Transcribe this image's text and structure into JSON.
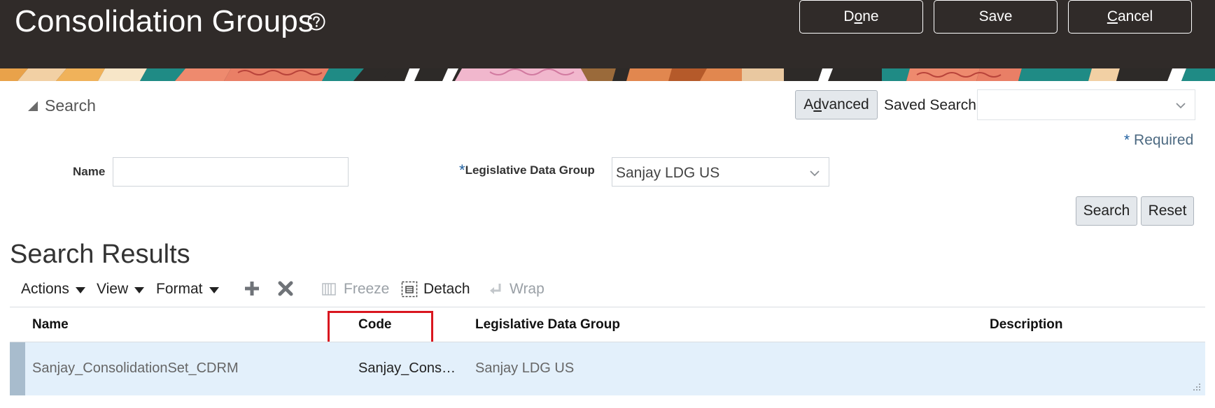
{
  "header": {
    "title": "Consolidation Groups",
    "help_icon": "help-question-circle-icon",
    "buttons": {
      "done_pre": "D",
      "done_ul": "o",
      "done_post": "ne",
      "save": "Save",
      "cancel_ul": "C",
      "cancel_post": "ancel"
    }
  },
  "search": {
    "toggle_label": "Search",
    "toggle_icon": "collapse-triangle-icon",
    "advanced_pre": "A",
    "advanced_ul": "d",
    "advanced_post": "vanced",
    "saved_search_label": "Saved Search",
    "saved_search_value": "",
    "required_star": "*",
    "required_label": "Required",
    "name_label": "Name",
    "name_value": "",
    "ldg_star": "*",
    "ldg_label": "Legislative Data Group",
    "ldg_value": "Sanjay LDG US",
    "search_button": "Search",
    "reset_button": "Reset"
  },
  "results": {
    "title": "Search Results",
    "toolbar": {
      "actions": "Actions",
      "view": "View",
      "format": "Format",
      "add_icon": "plus-icon",
      "delete_icon": "x-delete-icon",
      "freeze": "Freeze",
      "detach": "Detach",
      "wrap": "Wrap"
    },
    "columns": [
      "Name",
      "Code",
      "Legislative Data Group",
      "Description"
    ],
    "rows": [
      {
        "name": "Sanjay_ConsolidationSet_CDRM",
        "code": "Sanjay_Cons…",
        "ldg": "Sanjay LDG US",
        "description": ""
      }
    ]
  },
  "colors": {
    "header_bg": "#302b29",
    "highlight_box": "#d9161f",
    "selected_row": "#e3f0fb",
    "required_star": "#2060a0"
  }
}
